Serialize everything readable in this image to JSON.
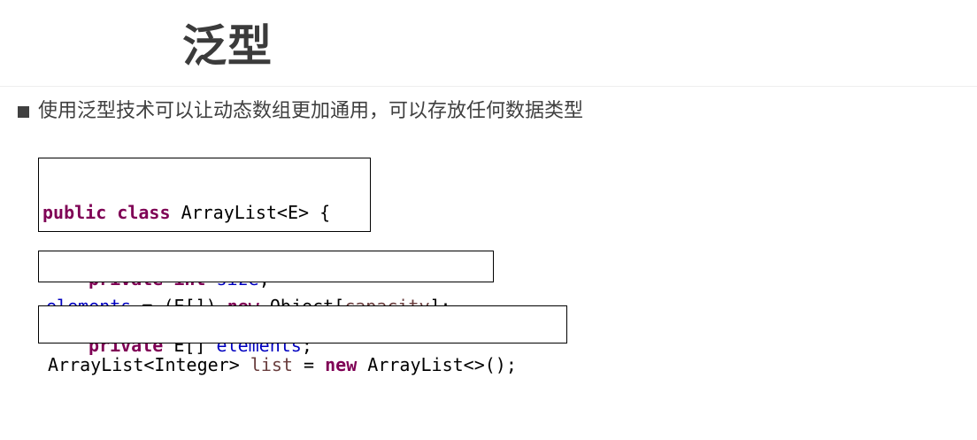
{
  "slide": {
    "title": "泛型",
    "bullet": "使用泛型技术可以让动态数组更加通用，可以存放任何数据类型"
  },
  "code": {
    "block1": {
      "line1": {
        "kw1": "public",
        "kw2": "class",
        "rest": "ArrayList<E> {"
      },
      "line2": {
        "kw1": "private",
        "kw2": "int",
        "field": "size",
        "end": ";"
      },
      "line3": {
        "kw1": "private",
        "type": "E[]",
        "field": "elements",
        "end": ";"
      }
    },
    "block2": {
      "field": "elements",
      "cast": "= (E[])",
      "kw": "new",
      "type": "Object[",
      "var": "capacity",
      "end": "];"
    },
    "block3": {
      "type": "ArrayList<Integer>",
      "var": "list",
      "op": "=",
      "kw": "new",
      "rest": "ArrayList<>();"
    }
  },
  "colors": {
    "keyword": "#7f0055",
    "field": "#0000c0",
    "local_variable": "#6a3e3e",
    "title_text": "#3b3b3b"
  }
}
